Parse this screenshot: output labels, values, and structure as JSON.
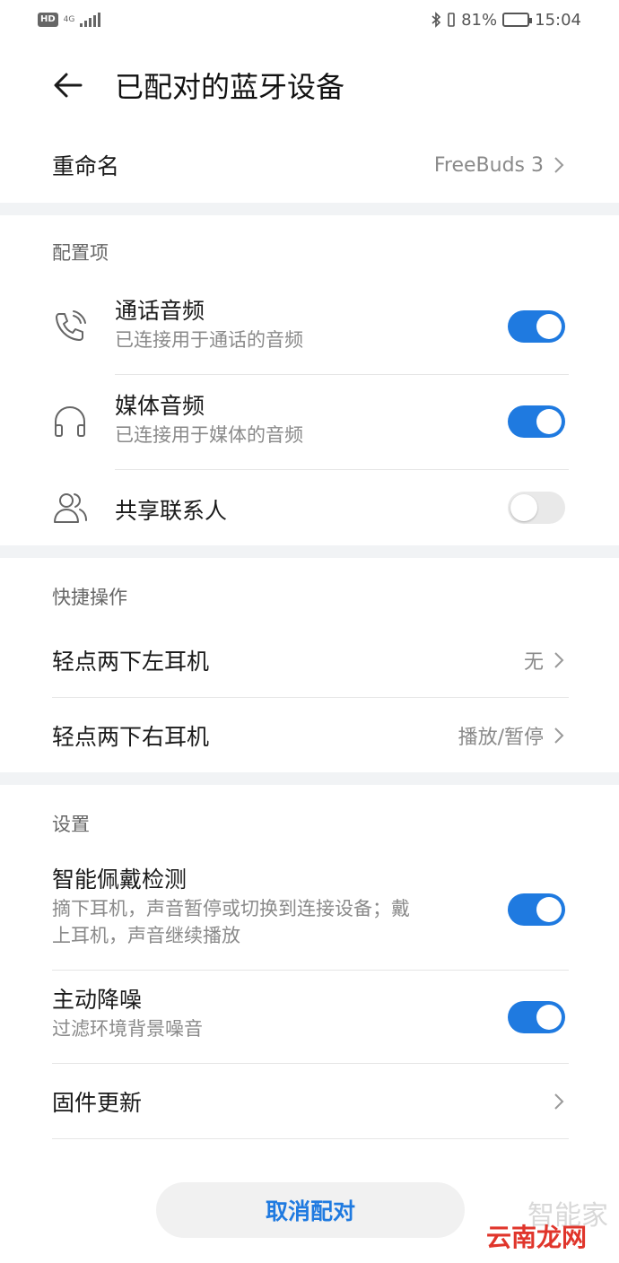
{
  "status_bar": {
    "hd": "HD",
    "network": "4G",
    "battery_percent": "81%",
    "battery_level": 0.81,
    "time": "15:04",
    "icons": [
      "bluetooth-icon",
      "vibrate-icon",
      "battery-icon",
      "signal-icon"
    ]
  },
  "header": {
    "back_icon": "arrow-left-icon",
    "title": "已配对的蓝牙设备"
  },
  "rename": {
    "label": "重命名",
    "value": "FreeBuds 3"
  },
  "config": {
    "section_title": "配置项",
    "call_audio": {
      "title": "通话音频",
      "subtitle": "已连接用于通话的音频",
      "icon": "phone-call-icon",
      "enabled": true
    },
    "media_audio": {
      "title": "媒体音频",
      "subtitle": "已连接用于媒体的音频",
      "icon": "headphones-icon",
      "enabled": true
    },
    "share_contacts": {
      "title": "共享联系人",
      "icon": "contacts-icon",
      "enabled": false
    }
  },
  "shortcuts": {
    "section_title": "快捷操作",
    "left_double_tap": {
      "label": "轻点两下左耳机",
      "value": "无"
    },
    "right_double_tap": {
      "label": "轻点两下右耳机",
      "value": "播放/暂停"
    }
  },
  "settings": {
    "section_title": "设置",
    "wear_detection": {
      "title": "智能佩戴检测",
      "subtitle_line1": "摘下耳机，声音暂停或切换到连接设备；戴",
      "subtitle_line2": "上耳机，声音继续播放",
      "enabled": true
    },
    "noise_cancel": {
      "title": "主动降噪",
      "subtitle": "过滤环境背景噪音",
      "enabled": true
    },
    "firmware": {
      "label": "固件更新"
    }
  },
  "unpair_label": "取消配对",
  "watermark": {
    "top": "智能家",
    "bottom": "云南龙网"
  },
  "colors": {
    "accent": "#1f7ae0",
    "toggle_off": "#e9e9e9",
    "section_gap": "#f1f3f5"
  }
}
